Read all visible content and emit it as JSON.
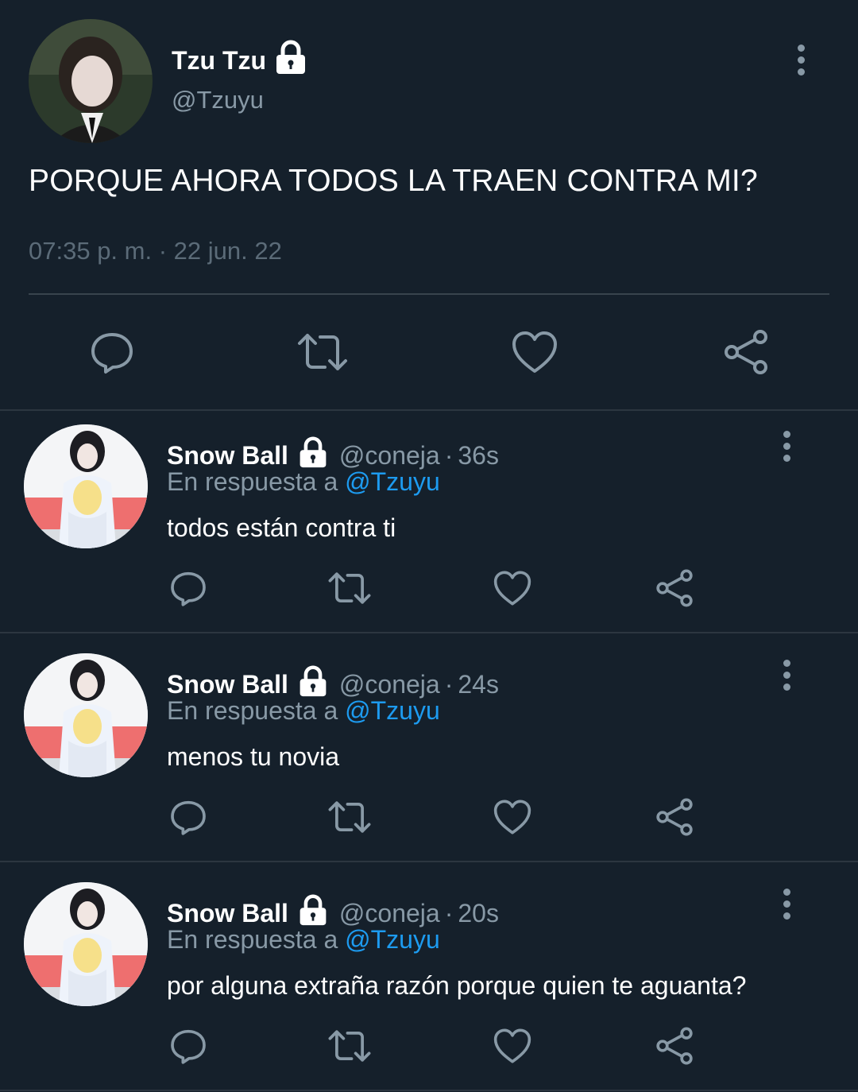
{
  "main_tweet": {
    "name": "Tzu Tzu",
    "handle": "@Tzuyu",
    "text": "PORQUE AHORA TODOS LA TRAEN CONTRA MI?",
    "timestamp": "07:35 p. m. · 22 jun. 22",
    "protected_icon": "lock-icon",
    "actions": [
      "reply-icon",
      "retweet-icon",
      "like-icon",
      "share-icon"
    ]
  },
  "replies": [
    {
      "name": "Snow Ball",
      "handle": "@coneja",
      "separator": "·",
      "time": "36s",
      "reply_prefix": "En respuesta a",
      "mention": "@Tzuyu",
      "text": "todos están contra ti"
    },
    {
      "name": "Snow Ball",
      "handle": "@coneja",
      "separator": "·",
      "time": "24s",
      "reply_prefix": "En respuesta a",
      "mention": "@Tzuyu",
      "text": "menos tu novia"
    },
    {
      "name": "Snow Ball",
      "handle": "@coneja",
      "separator": "·",
      "time": "20s",
      "reply_prefix": "En respuesta a",
      "mention": "@Tzuyu",
      "text": "por alguna extraña razón porque quien te aguanta?"
    }
  ],
  "colors": {
    "background": "#15202b",
    "secondary_text": "#8899a6",
    "mention": "#1d9bf0",
    "divider": "#38444d"
  }
}
